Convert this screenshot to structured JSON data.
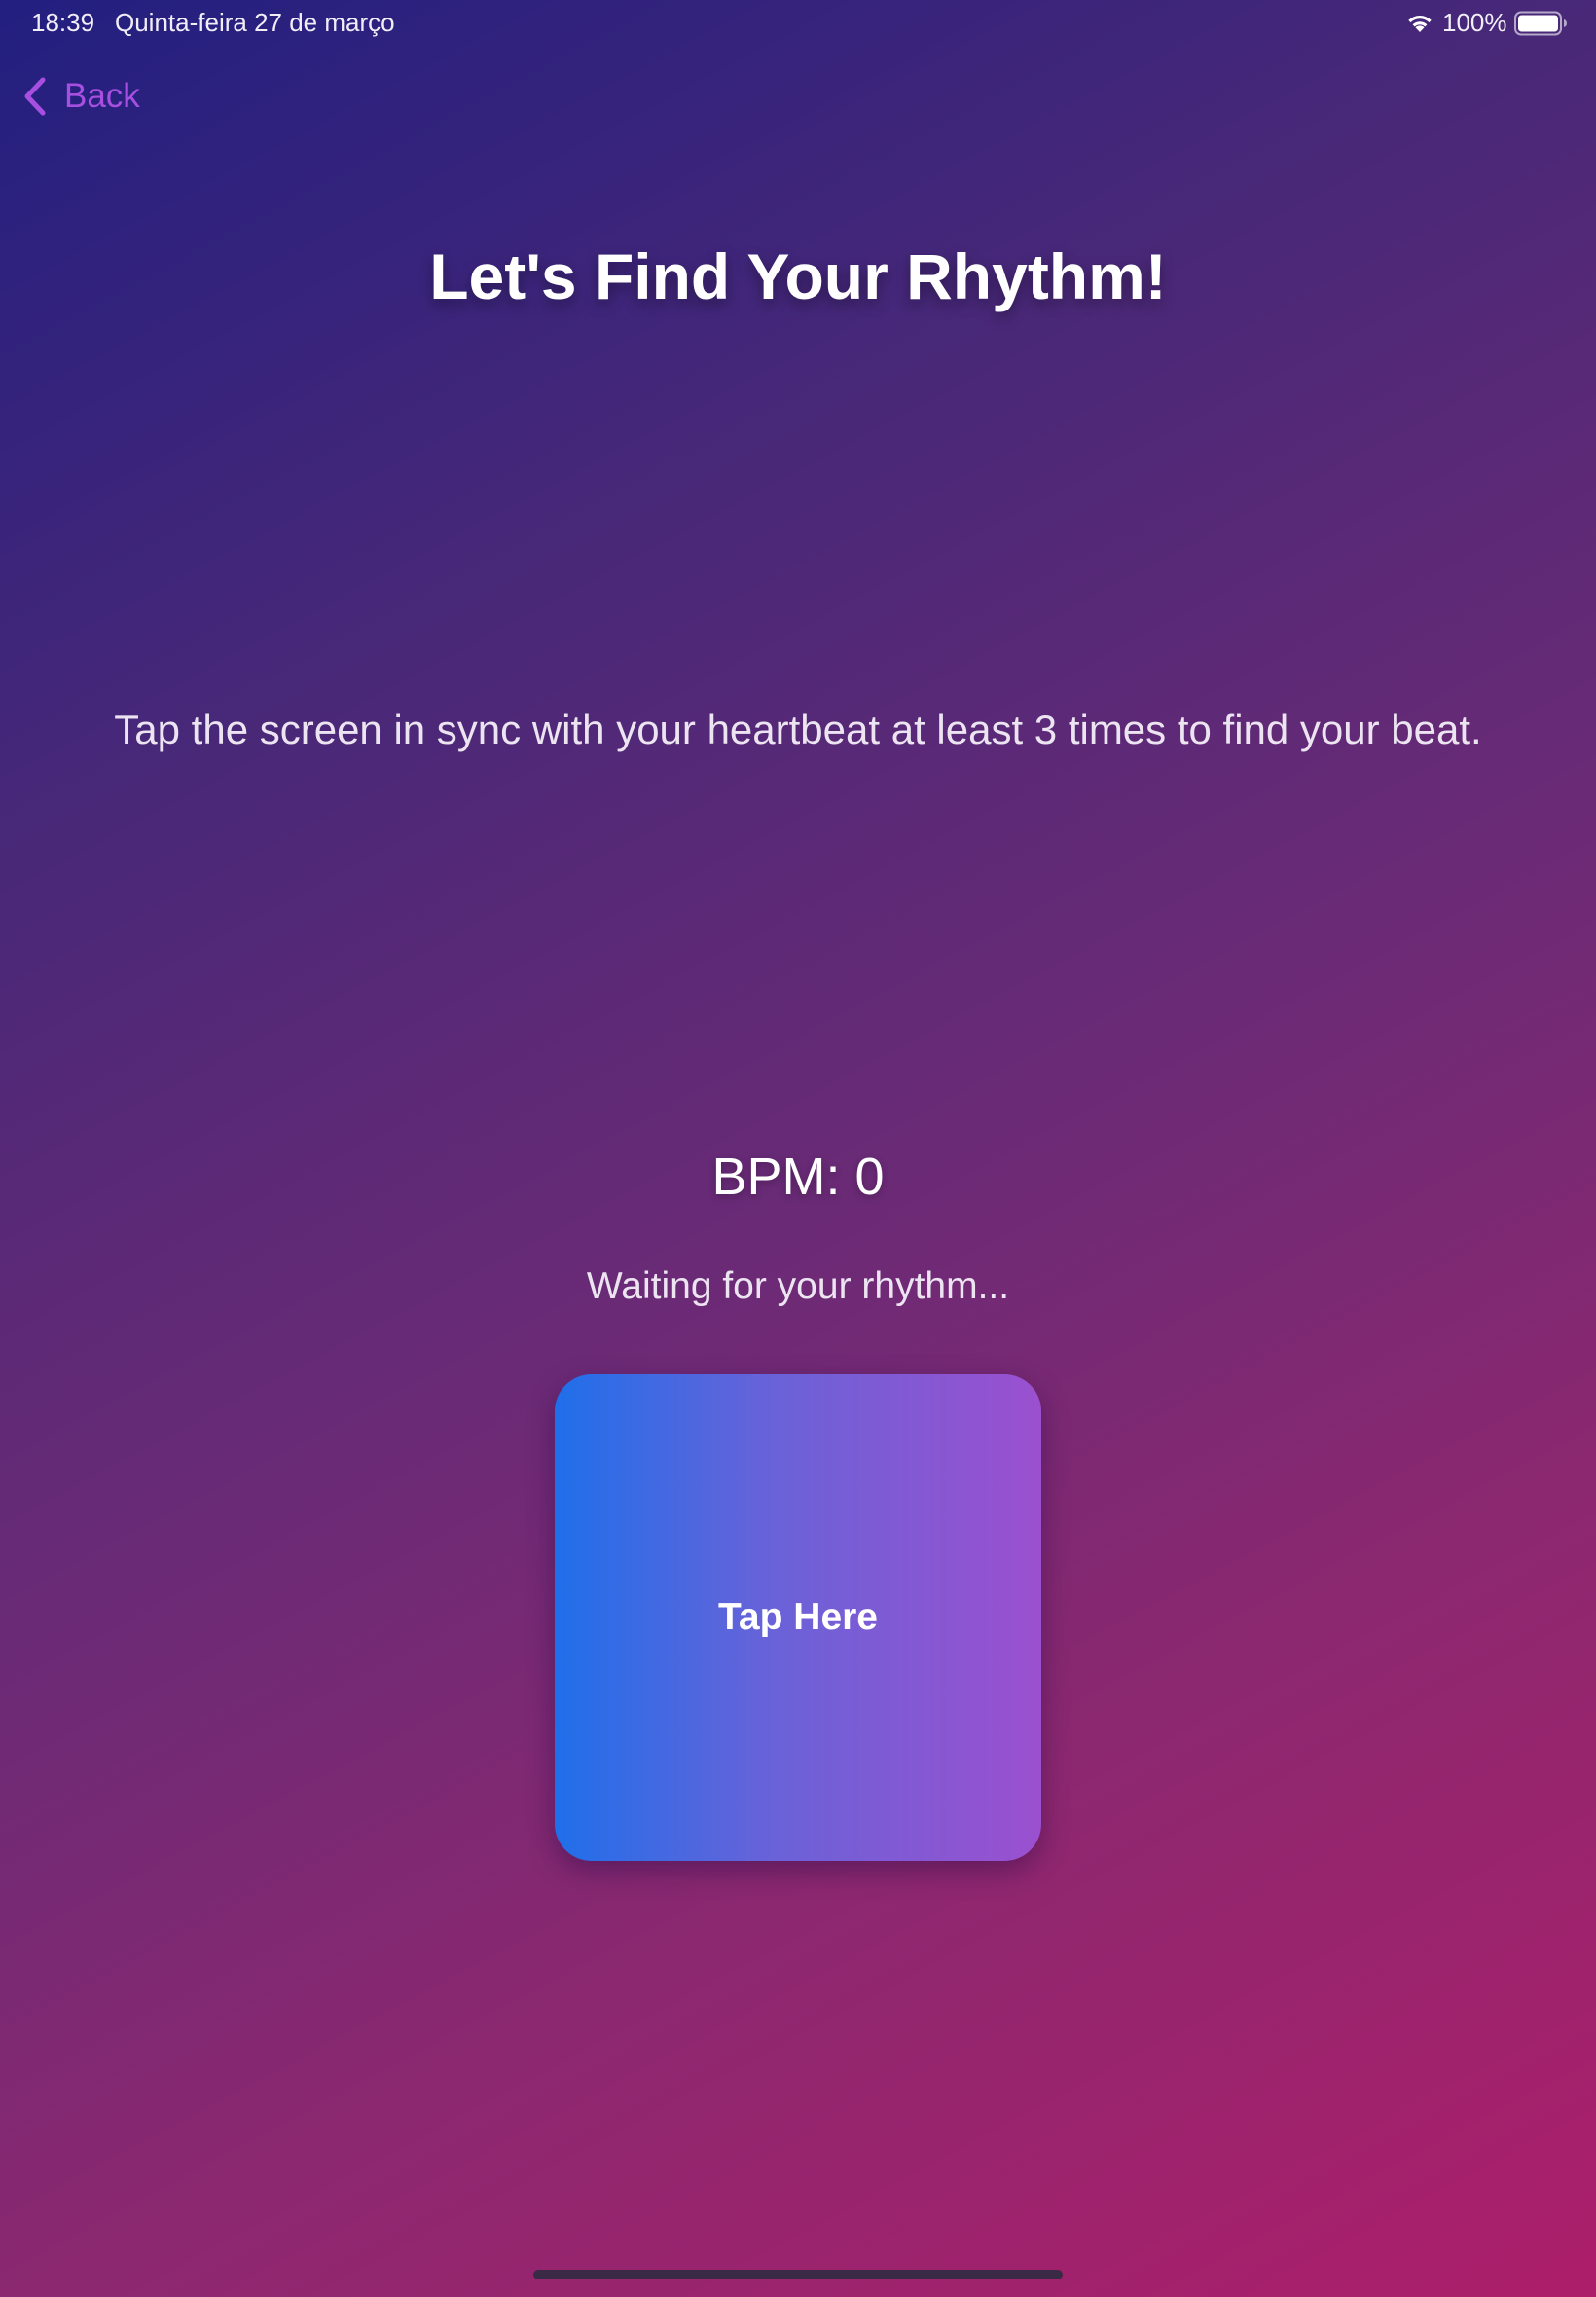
{
  "status_bar": {
    "time": "18:39",
    "date": "Quinta-feira 27 de março",
    "battery_percent": "100%",
    "battery_level": 1.0
  },
  "nav": {
    "back_label": "Back"
  },
  "main": {
    "title": "Let's Find Your Rhythm!",
    "instructions": "Tap the screen in sync with your heartbeat at least 3 times to find your beat.",
    "bpm_label": "BPM: ",
    "bpm_value": "0",
    "status_message": "Waiting for your rhythm...",
    "tap_button_label": "Tap Here"
  },
  "icons": {
    "back": "chevron-left-icon",
    "wifi": "wifi-icon",
    "battery": "battery-icon"
  },
  "colors": {
    "accent": "#a64fe0",
    "background_top": "#221f80",
    "background_bottom": "#ad1e6a",
    "tap_button_start": "#1f6fea",
    "tap_button_end": "#9b50cf"
  }
}
